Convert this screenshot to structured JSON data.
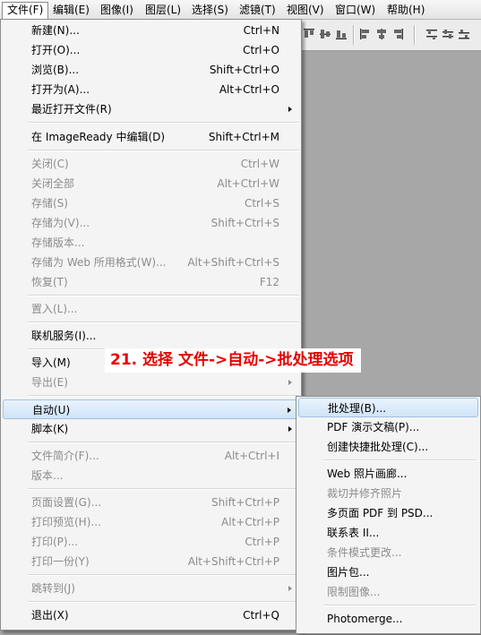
{
  "menubar": {
    "items": [
      "文件(F)",
      "编辑(E)",
      "图像(I)",
      "图层(L)",
      "选择(S)",
      "滤镜(T)",
      "视图(V)",
      "窗口(W)",
      "帮助(H)"
    ]
  },
  "file_menu": {
    "items": [
      {
        "label": "新建(N)...",
        "shortcut": "Ctrl+N"
      },
      {
        "label": "打开(O)...",
        "shortcut": "Ctrl+O"
      },
      {
        "label": "浏览(B)...",
        "shortcut": "Shift+Ctrl+O"
      },
      {
        "label": "打开为(A)...",
        "shortcut": "Alt+Ctrl+O"
      },
      {
        "label": "最近打开文件(R)",
        "shortcut": ""
      },
      {
        "label": "在 ImageReady 中编辑(D)",
        "shortcut": "Shift+Ctrl+M"
      },
      {
        "label": "关闭(C)",
        "shortcut": "Ctrl+W"
      },
      {
        "label": "关闭全部",
        "shortcut": "Alt+Ctrl+W"
      },
      {
        "label": "存储(S)",
        "shortcut": "Ctrl+S"
      },
      {
        "label": "存储为(V)...",
        "shortcut": "Shift+Ctrl+S"
      },
      {
        "label": "存储版本...",
        "shortcut": ""
      },
      {
        "label": "存储为 Web 所用格式(W)...",
        "shortcut": "Alt+Shift+Ctrl+S"
      },
      {
        "label": "恢复(T)",
        "shortcut": "F12"
      },
      {
        "label": "置入(L)...",
        "shortcut": ""
      },
      {
        "label": "联机服务(I)...",
        "shortcut": ""
      },
      {
        "label": "导入(M)",
        "shortcut": ""
      },
      {
        "label": "导出(E)",
        "shortcut": ""
      },
      {
        "label": "自动(U)",
        "shortcut": ""
      },
      {
        "label": "脚本(K)",
        "shortcut": ""
      },
      {
        "label": "文件简介(F)...",
        "shortcut": "Alt+Ctrl+I"
      },
      {
        "label": "版本...",
        "shortcut": ""
      },
      {
        "label": "页面设置(G)...",
        "shortcut": "Shift+Ctrl+P"
      },
      {
        "label": "打印预览(H)...",
        "shortcut": "Alt+Ctrl+P"
      },
      {
        "label": "打印(P)...",
        "shortcut": "Ctrl+P"
      },
      {
        "label": "打印一份(Y)",
        "shortcut": "Alt+Shift+Ctrl+P"
      },
      {
        "label": "跳转到(J)",
        "shortcut": ""
      },
      {
        "label": "退出(X)",
        "shortcut": "Ctrl+Q"
      }
    ]
  },
  "auto_submenu": {
    "items": [
      {
        "label": "批处理(B)..."
      },
      {
        "label": "PDF 演示文稿(P)..."
      },
      {
        "label": "创建快捷批处理(C)..."
      },
      {
        "label": "Web 照片画廊..."
      },
      {
        "label": "裁切并修齐照片"
      },
      {
        "label": "多页面 PDF 到 PSD..."
      },
      {
        "label": "联系表 II..."
      },
      {
        "label": "条件模式更改..."
      },
      {
        "label": "图片包..."
      },
      {
        "label": "限制图像..."
      },
      {
        "label": "Photomerge..."
      }
    ]
  },
  "annotation": {
    "text": "21. 选择 文件->自动->批处理选项"
  },
  "colors": {
    "annotation_text": "#e60000",
    "highlight": "#cfe4f8",
    "canvas_bg": "#a7a7a7"
  }
}
